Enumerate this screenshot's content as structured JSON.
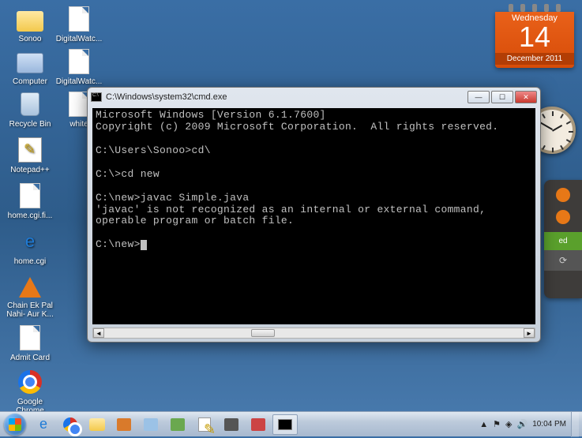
{
  "desktop": {
    "icons": [
      {
        "label": "Sonoo",
        "type": "folder"
      },
      {
        "label": "DigitalWatc...",
        "type": "page"
      },
      {
        "label": "Computer",
        "type": "computer"
      },
      {
        "label": "DigitalWatc...",
        "type": "page"
      },
      {
        "label": "Recycle Bin",
        "type": "bin"
      },
      {
        "label": "white",
        "type": "page"
      },
      {
        "label": "Notepad++",
        "type": "notepadpp"
      },
      {
        "label": "home.cgi.fi...",
        "type": "page"
      },
      {
        "label": "home.cgi",
        "type": "ie"
      },
      {
        "label": "Chain Ek Pal Nahi- Aur K...",
        "type": "vlc"
      },
      {
        "label": "Admit Card",
        "type": "page"
      },
      {
        "label": "Google Chrome",
        "type": "chrome"
      }
    ]
  },
  "calendar": {
    "weekday": "Wednesday",
    "date": "14",
    "month_year": "December 2011"
  },
  "side_panel": {
    "green_label": "ed",
    "refresh_glyph": "⟳"
  },
  "cmd": {
    "title": "C:\\Windows\\system32\\cmd.exe",
    "lines": [
      "Microsoft Windows [Version 6.1.7600]",
      "Copyright (c) 2009 Microsoft Corporation.  All rights reserved.",
      "",
      "C:\\Users\\Sonoo>cd\\",
      "",
      "C:\\>cd new",
      "",
      "C:\\new>javac Simple.java",
      "'javac' is not recognized as an internal or external command,",
      "operable program or batch file.",
      "",
      "C:\\new>"
    ],
    "controls": {
      "min": "—",
      "max": "☐",
      "close": "✕"
    }
  },
  "taskbar": {
    "tray": {
      "time": "10:04 PM",
      "flag": "▲",
      "net": "◈",
      "vol": "🔊",
      "action": "⚑"
    }
  }
}
